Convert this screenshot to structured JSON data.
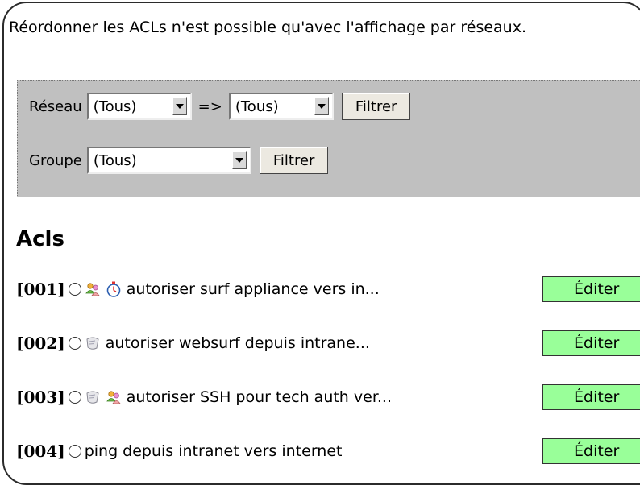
{
  "intro_text": "Réordonner les ACLs n'est possible qu'avec l'affichage par réseaux.",
  "filters": {
    "network_label": "Réseau",
    "network_from": "(Tous)",
    "arrow_sep": "=>",
    "network_to": "(Tous)",
    "network_filter_button": "Filtrer",
    "group_label": "Groupe",
    "group_value": "(Tous)",
    "group_filter_button": "Filtrer"
  },
  "section_title": "Acls",
  "edit_label": "Éditer",
  "acls": [
    {
      "num": "[001]",
      "name": "autoriser surf appliance vers in...",
      "icons": [
        "users-icon",
        "clock-icon"
      ]
    },
    {
      "num": "[002]",
      "name": "autoriser websurf depuis intrane...",
      "icons": [
        "log-icon"
      ]
    },
    {
      "num": "[003]",
      "name": "autoriser SSH pour tech auth ver...",
      "icons": [
        "log-icon",
        "users-icon"
      ]
    },
    {
      "num": "[004]",
      "name": "ping depuis intranet vers internet",
      "icons": []
    }
  ],
  "colors": {
    "filter_bg": "#c0c0c0",
    "edit_bg": "#99ff99"
  }
}
